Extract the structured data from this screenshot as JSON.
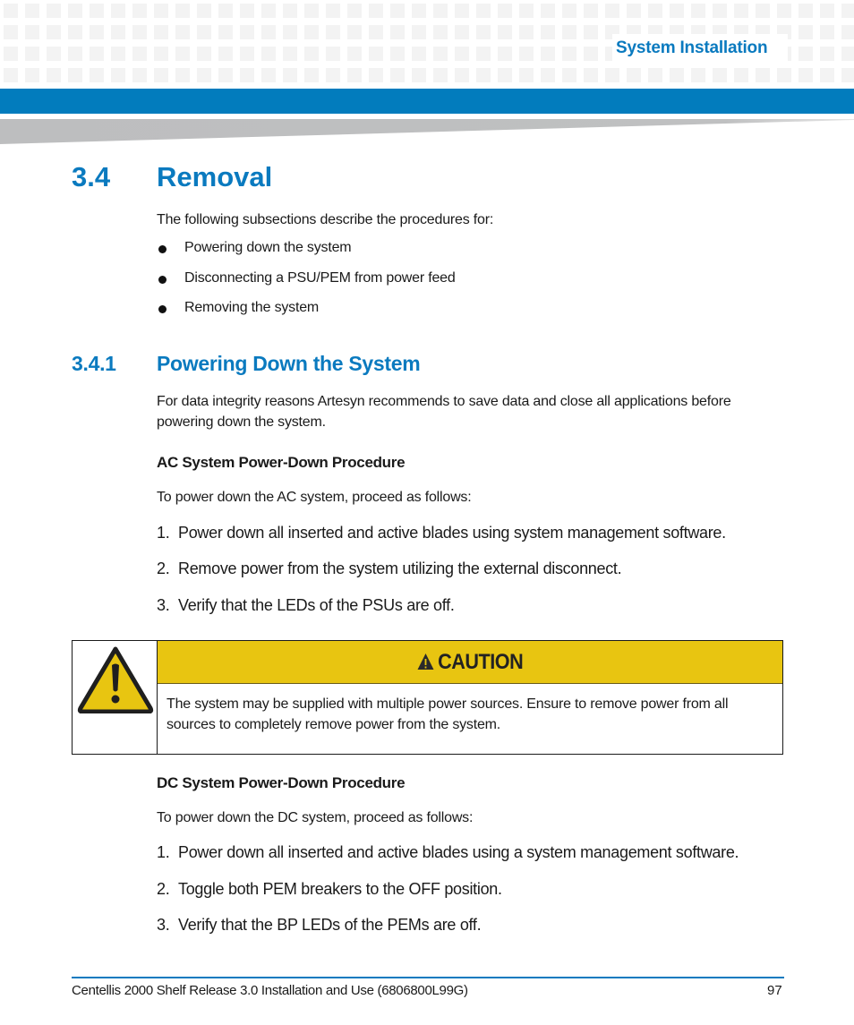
{
  "header": {
    "section_title": "System Installation",
    "colors": {
      "accent_blue": "#027cbd",
      "heading_blue": "#0a7abf",
      "caution_yellow": "#e8c511"
    }
  },
  "section": {
    "number": "3.4",
    "title": "Removal",
    "intro": "The following subsections describe the procedures for:",
    "bullets": [
      "Powering down the system",
      "Disconnecting a PSU/PEM from power feed",
      "Removing the system"
    ]
  },
  "subsection": {
    "number": "3.4.1",
    "title": "Powering Down the System",
    "intro_lines": [
      "For data integrity reasons Artesyn recommends to save data and close all applications before",
      "powering down the system."
    ],
    "ac": {
      "heading": "AC System Power-Down Procedure",
      "lead": "To power down the AC system, proceed as follows:",
      "steps": [
        {
          "num": "1.",
          "text": "Power down all inserted and active blades using system management software."
        },
        {
          "num": "2.",
          "text": "Remove power from the system utilizing the external disconnect."
        },
        {
          "num": "3.",
          "text": "Verify that the LEDs of the PSUs are off."
        }
      ]
    },
    "caution": {
      "icon": "warning-triangle-icon",
      "label": "CAUTION",
      "lines": [
        "The system may be supplied with multiple power sources. Ensure to remove power from all",
        "sources to completely remove power from the system."
      ]
    },
    "dc": {
      "heading": "DC System Power-Down Procedure",
      "lead": "To power down the DC system, proceed as follows:",
      "steps": [
        {
          "num": "1.",
          "text": "Power down all inserted and active blades using a system management software."
        },
        {
          "num": "2.",
          "text": "Toggle both PEM breakers to the OFF position."
        },
        {
          "num": "3.",
          "text": "Verify that the BP LEDs of the PEMs are off."
        }
      ]
    }
  },
  "footer": {
    "document_title": "Centellis 2000 Shelf Release 3.0 Installation and Use (6806800L99G)",
    "page_number": "97"
  }
}
